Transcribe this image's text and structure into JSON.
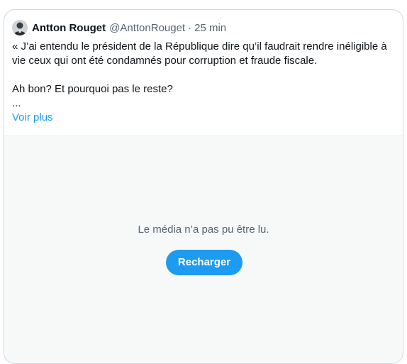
{
  "tweet": {
    "author_name": "Antton Rouget",
    "author_handle": "@AnttonRouget",
    "separator": "·",
    "time": "25 min",
    "avatar_icon": "profile-photo",
    "text_line1": "« J’ai entendu le président de la République dire qu’il faudrait rendre inéligible à vie ceux qui ont été condamnés pour corruption et fraude fiscale.",
    "text_line2": "Ah bon? Et pourquoi pas le reste?",
    "text_line3": "...",
    "show_more_label": "Voir plus"
  },
  "media": {
    "error_message": "Le média n’a pas pu être lu.",
    "reload_label": "Recharger"
  },
  "colors": {
    "accent": "#1d9bf0",
    "text_primary": "#0f1419",
    "text_secondary": "#536471",
    "media_background": "#f7f9f9",
    "border": "#cfd9de"
  }
}
